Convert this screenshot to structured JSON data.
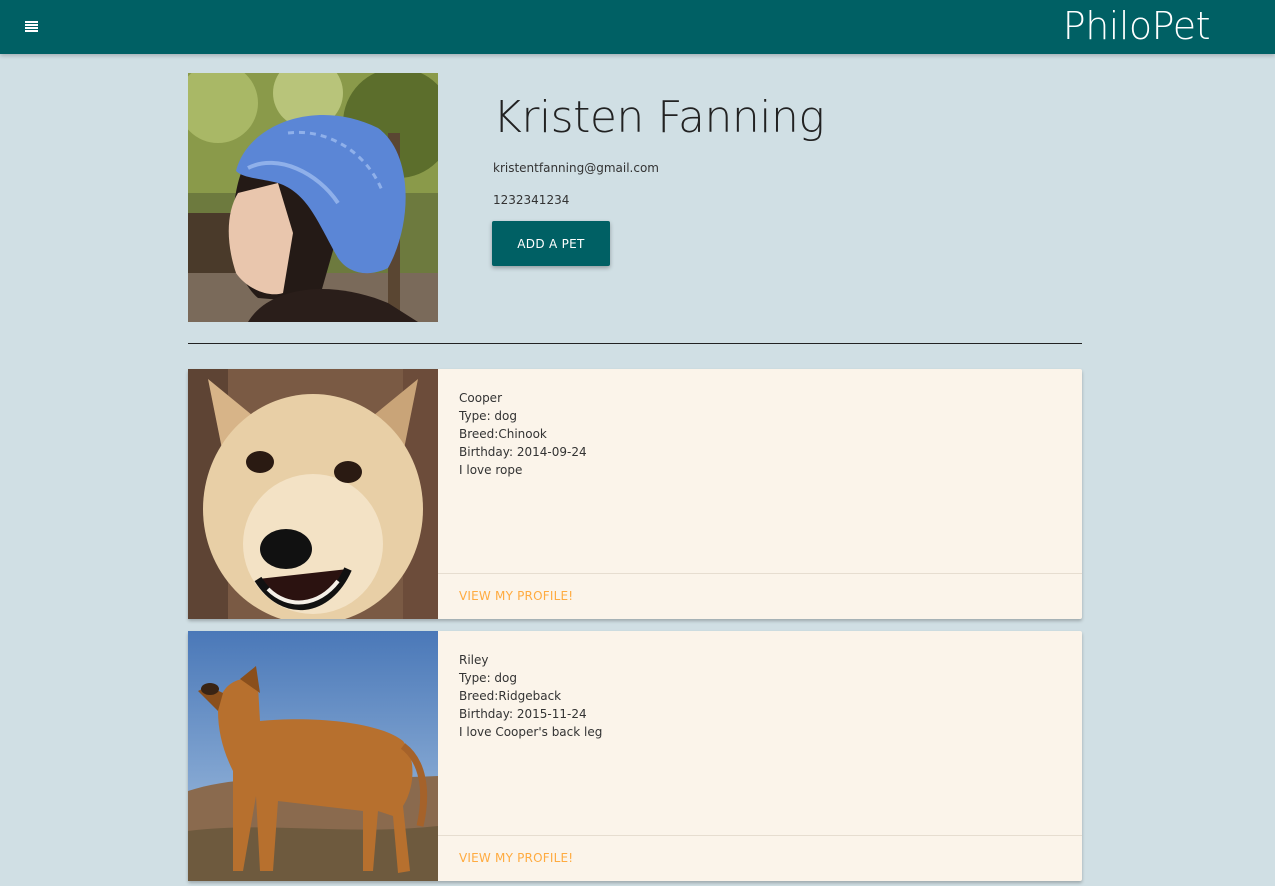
{
  "app": {
    "brand": "PhiloPet"
  },
  "profile": {
    "name": "Kristen Fanning",
    "email": "kristentfanning@gmail.com",
    "phone": "1232341234",
    "add_pet_label": "ADD A PET"
  },
  "pets": [
    {
      "name": "Cooper",
      "type": "Type: dog",
      "breed": "Breed:Chinook",
      "birthday": "Birthday: 2014-09-24",
      "bio": "I love rope",
      "action_label": "VIEW MY PROFILE!"
    },
    {
      "name": "Riley",
      "type": "Type: dog",
      "breed": "Breed:Ridgeback",
      "birthday": "Birthday: 2015-11-24",
      "bio": "I love Cooper's back leg",
      "action_label": "VIEW MY PROFILE!"
    }
  ],
  "colors": {
    "primary": "#006064",
    "background": "#d0dfe4",
    "card": "#fbf4ea",
    "accent": "#ffab40"
  }
}
